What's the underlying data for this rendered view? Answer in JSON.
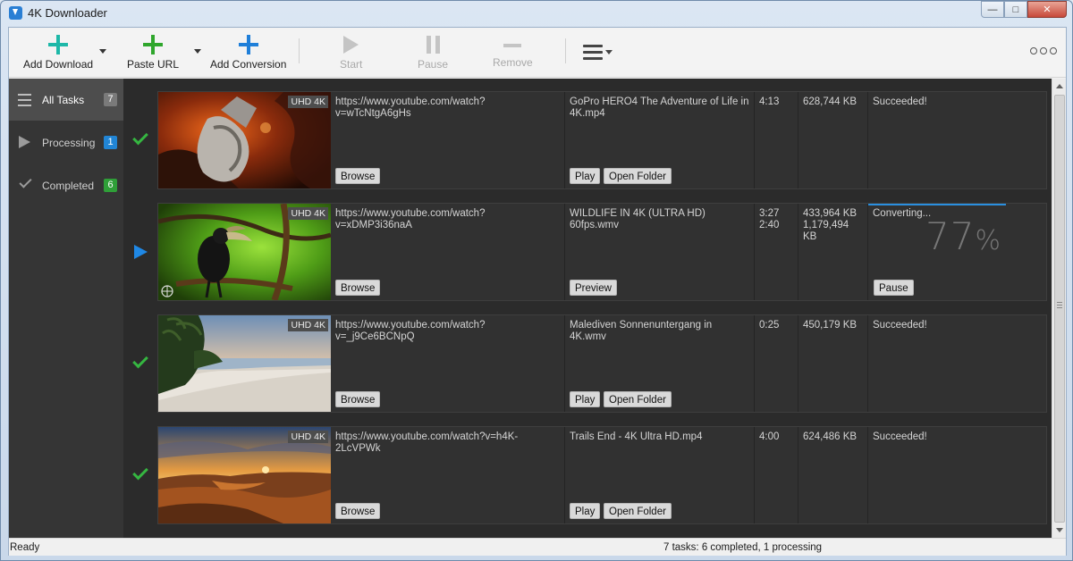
{
  "window": {
    "title": "4K Downloader"
  },
  "toolbar": {
    "add_download": "Add Download",
    "paste_url": "Paste URL",
    "add_conversion": "Add Conversion",
    "start": "Start",
    "pause": "Pause",
    "remove": "Remove"
  },
  "sidebar": {
    "items": [
      {
        "label": "All Tasks",
        "count": "7"
      },
      {
        "label": "Processing",
        "count": "1"
      },
      {
        "label": "Completed",
        "count": "6"
      }
    ]
  },
  "tasks": [
    {
      "badge": "UHD 4K",
      "url": "https://www.youtube.com/watch?v=wTcNtgA6gHs",
      "browse": "Browse",
      "filename": "GoPro HERO4  The Adventure of Life in 4K.mp4",
      "btn1": "Play",
      "btn2": "Open Folder",
      "duration": "4:13",
      "duration2": "",
      "size": "628,744 KB",
      "size2": "",
      "status": "Succeeded!"
    },
    {
      "badge": "UHD 4K",
      "url": "https://www.youtube.com/watch?v=xDMP3i36naA",
      "browse": "Browse",
      "filename": "WILDLIFE IN 4K (ULTRA HD) 60fps.wmv",
      "btn1": "Preview",
      "duration": "3:27",
      "duration2": "2:40",
      "size": "433,964 KB",
      "size2": "1,179,494 KB",
      "status": "Converting...",
      "percent": "77",
      "percent_sign": "%",
      "progress": 0.77,
      "action": "Pause"
    },
    {
      "badge": "UHD 4K",
      "url": "https://www.youtube.com/watch?v=_j9Ce6BCNpQ",
      "browse": "Browse",
      "filename": "Malediven Sonnenuntergang in 4K.wmv",
      "btn1": "Play",
      "btn2": "Open Folder",
      "duration": "0:25",
      "size": "450,179 KB",
      "status": "Succeeded!"
    },
    {
      "badge": "UHD 4K",
      "url": "https://www.youtube.com/watch?v=h4K-2LcVPWk",
      "browse": "Browse",
      "filename": "Trails End - 4K Ultra HD.mp4",
      "btn1": "Play",
      "btn2": "Open Folder",
      "duration": "4:00",
      "size": "624,486 KB",
      "status": "Succeeded!"
    }
  ],
  "statusbar": {
    "left": "Ready",
    "right": "7 tasks: 6 completed, 1 processing"
  },
  "colors": {
    "accent": "#2a8fe0",
    "success": "#35b641",
    "sidebar_bg": "#353535",
    "list_bg": "#2b2b2b"
  }
}
